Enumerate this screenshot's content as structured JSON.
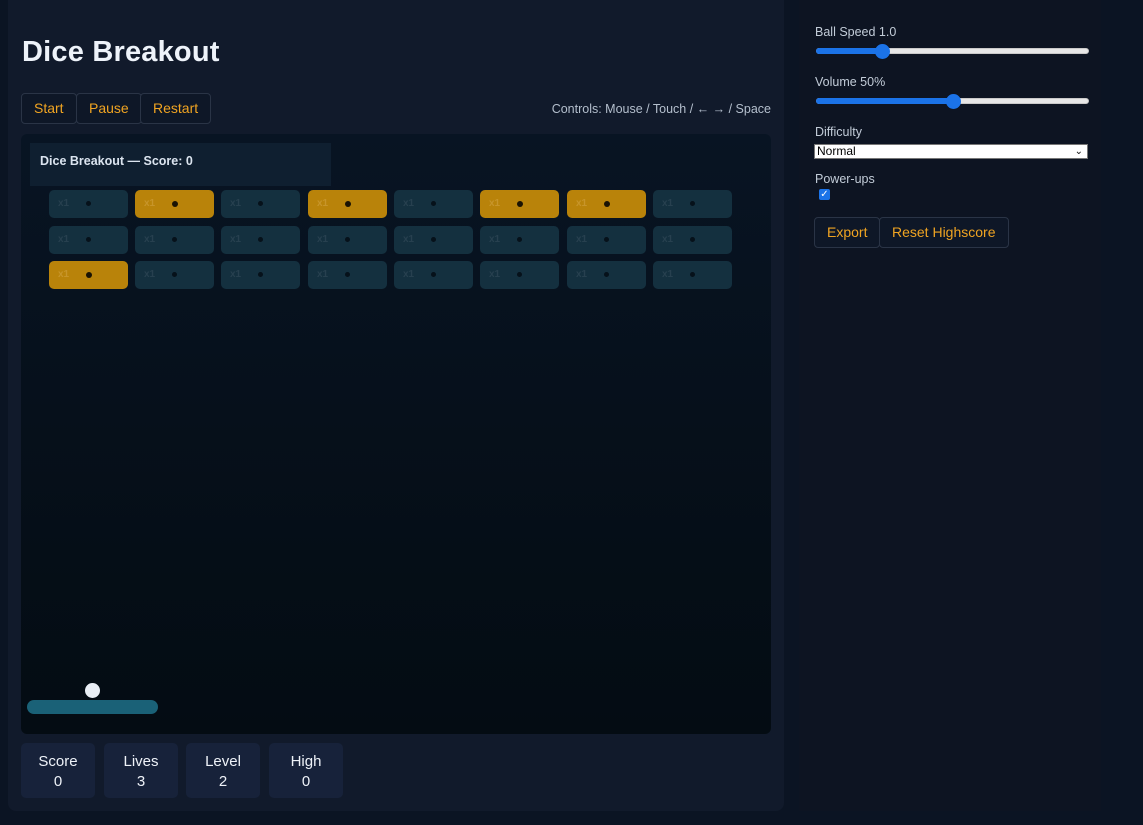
{
  "app": {
    "title": "Dice Breakout",
    "controls_hint": "Controls: Mouse / Touch / ← → / Space"
  },
  "toolbar": {
    "start_label": "Start",
    "pause_label": "Pause",
    "restart_label": "Restart"
  },
  "board": {
    "label": "Dice Breakout — Score: 0",
    "brick_multiplier": "x1",
    "rows": [
      [
        "dim",
        "gold",
        "dim",
        "gold",
        "dim",
        "gold",
        "gold",
        "dim"
      ],
      [
        "dim",
        "dim",
        "dim",
        "dim",
        "dim",
        "dim",
        "dim",
        "dim"
      ],
      [
        "gold",
        "dim",
        "dim",
        "dim",
        "dim",
        "dim",
        "dim",
        "dim"
      ]
    ]
  },
  "stats": [
    {
      "label": "Score",
      "value": "0"
    },
    {
      "label": "Lives",
      "value": "3"
    },
    {
      "label": "Level",
      "value": "2"
    },
    {
      "label": "High",
      "value": "0"
    }
  ],
  "settings": {
    "ball_speed_label": "Ball Speed 1.0",
    "ball_speed_fraction": 0.24,
    "volume_label": "Volume 50%",
    "volume_fraction": 0.5,
    "difficulty_label": "Difficulty",
    "difficulty_value": "Normal",
    "powerups_label": "Power-ups",
    "powerups_checked": true,
    "export_label": "Export",
    "reset_highscore_label": "Reset Highscore"
  },
  "colors": {
    "accent": "#f0a422",
    "gold_brick": "#b9830a",
    "dim_brick": "#14303f",
    "paddle": "#1a6177",
    "slider": "#1b73e8"
  }
}
